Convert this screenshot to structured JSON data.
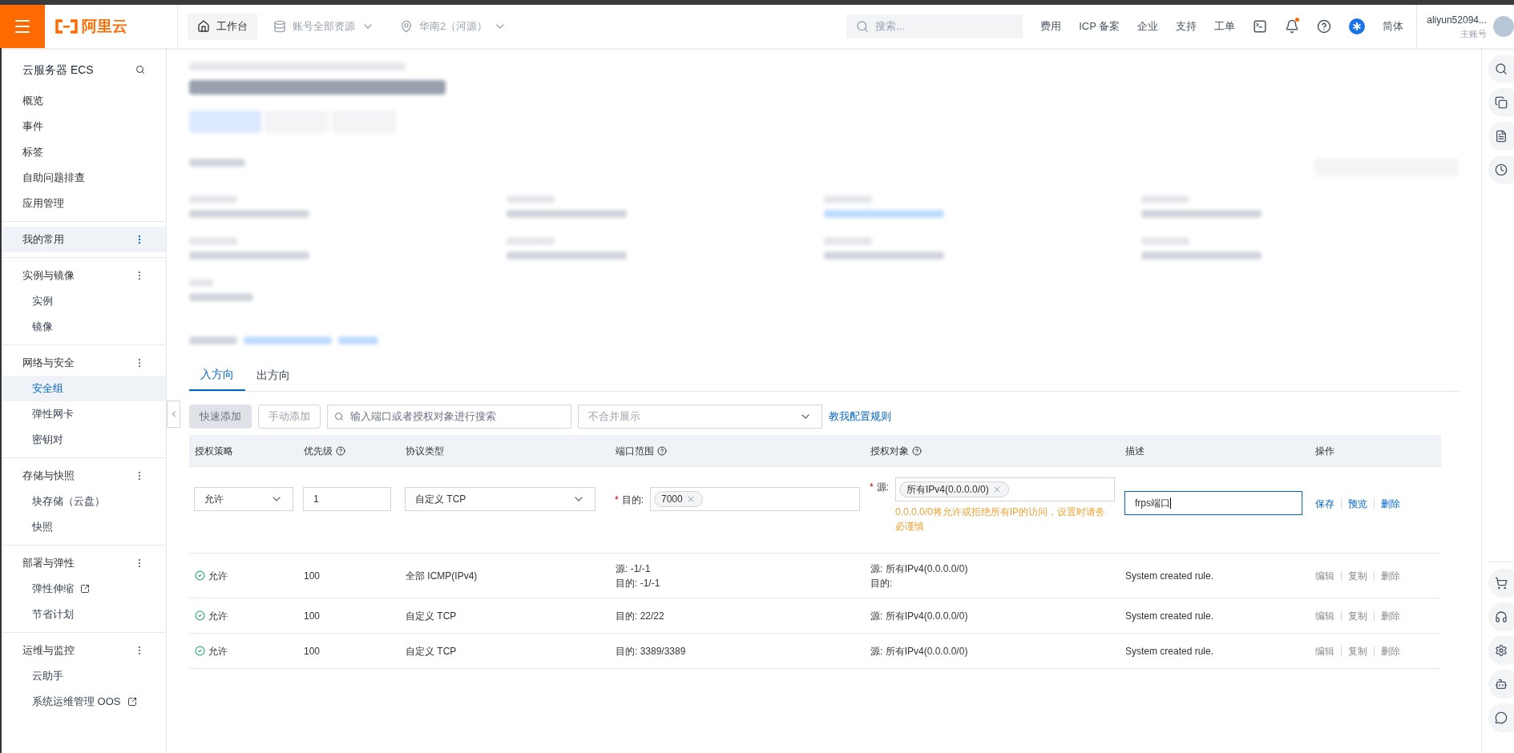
{
  "top_bar": {
    "logo_text": "阿里云",
    "workbench": "工作台",
    "account_scope": "账号全部资源",
    "region": "华南2（河源）",
    "search_placeholder": "搜索...",
    "links": [
      "费用",
      "ICP 备案",
      "企业",
      "支持",
      "工单"
    ],
    "notification_dot": true,
    "language": "简体",
    "user": "aliyun52094...",
    "user_role": "主账号"
  },
  "sidebar": {
    "title": "云服务器 ECS",
    "items": [
      {
        "label": "概览",
        "selected": false
      },
      {
        "label": "事件",
        "selected": false
      },
      {
        "label": "标签",
        "selected": false
      },
      {
        "label": "自助问题排查",
        "selected": false
      },
      {
        "label": "应用管理",
        "selected": false
      }
    ],
    "groups": [
      {
        "title": "我的常用",
        "selected": true
      },
      {
        "title": "实例与镜像",
        "selected": false,
        "items": [
          {
            "label": "实例",
            "selected": false,
            "external": false
          },
          {
            "label": "镜像",
            "selected": false,
            "external": false
          }
        ]
      },
      {
        "title": "网络与安全",
        "selected": false,
        "items": [
          {
            "label": "安全组",
            "selected": true,
            "external": false
          },
          {
            "label": "弹性网卡",
            "selected": false,
            "external": false
          },
          {
            "label": "密钥对",
            "selected": false,
            "external": false
          }
        ]
      },
      {
        "title": "存储与快照",
        "selected": false,
        "items": [
          {
            "label": "块存储（云盘）",
            "selected": false,
            "external": false
          },
          {
            "label": "快照",
            "selected": false,
            "external": false
          }
        ]
      },
      {
        "title": "部署与弹性",
        "selected": false,
        "items": [
          {
            "label": "弹性伸缩",
            "selected": false,
            "external": true
          },
          {
            "label": "节省计划",
            "selected": false,
            "external": false
          }
        ]
      },
      {
        "title": "运维与监控",
        "selected": false,
        "items": [
          {
            "label": "云助手",
            "selected": false,
            "external": false
          },
          {
            "label": "系统运维管理 OOS",
            "selected": false,
            "external": true
          }
        ]
      }
    ]
  },
  "tabs": [
    {
      "label": "入方向",
      "selected": true
    },
    {
      "label": "出方向",
      "selected": false
    }
  ],
  "toolbar": {
    "quick_add": {
      "label": "快速添加",
      "disabled": true
    },
    "manual_add": {
      "label": "手动添加",
      "disabled": true
    },
    "search_placeholder": "输入端口或者授权对象进行搜索",
    "merge_select": "不合并展示",
    "help_link": "教我配置规则"
  },
  "table": {
    "columns": [
      {
        "label": "授权策略"
      },
      {
        "label": "优先级",
        "help": true
      },
      {
        "label": "协议类型"
      },
      {
        "label": "端口范围",
        "help": true
      },
      {
        "label": "授权对象",
        "help": true
      },
      {
        "label": "描述"
      },
      {
        "label": "操作"
      }
    ],
    "edit_row": {
      "required_mark": "*",
      "policy": "允许",
      "priority": "1",
      "protocol": "自定义 TCP",
      "port_label": "目的:",
      "port_tags": [
        "7000"
      ],
      "source_label": "源:",
      "source_tags": [
        "所有IPv4(0.0.0.0/0)"
      ],
      "warning": "0.0.0.0/0将允许或拒绝所有IP的访问，设置时请务必谨慎",
      "description": "frps端口",
      "actions": [
        "保存",
        "预览",
        "删除"
      ]
    },
    "rows": [
      {
        "policy": "允许",
        "priority": "100",
        "protocol": "全部 ICMP(IPv4)",
        "port_lines": [
          "源: -1/-1",
          "目的: -1/-1"
        ],
        "target_lines": [
          "源: 所有IPv4(0.0.0.0/0)",
          "目的:"
        ],
        "description": "System created rule.",
        "actions": [
          "编辑",
          "复制",
          "删除"
        ],
        "actions_disabled": true
      },
      {
        "policy": "允许",
        "priority": "100",
        "protocol": "自定义 TCP",
        "port_lines": [
          "目的: 22/22"
        ],
        "target_lines": [
          "源: 所有IPv4(0.0.0.0/0)"
        ],
        "description": "System created rule.",
        "actions": [
          "编辑",
          "复制",
          "删除"
        ],
        "actions_disabled": true
      },
      {
        "policy": "允许",
        "priority": "100",
        "protocol": "自定义 TCP",
        "port_lines": [
          "目的: 3389/3389"
        ],
        "target_lines": [
          "源: 所有IPv4(0.0.0.0/0)"
        ],
        "description": "System created rule.",
        "actions": [
          "编辑",
          "复制",
          "删除"
        ],
        "actions_disabled": true
      }
    ]
  }
}
